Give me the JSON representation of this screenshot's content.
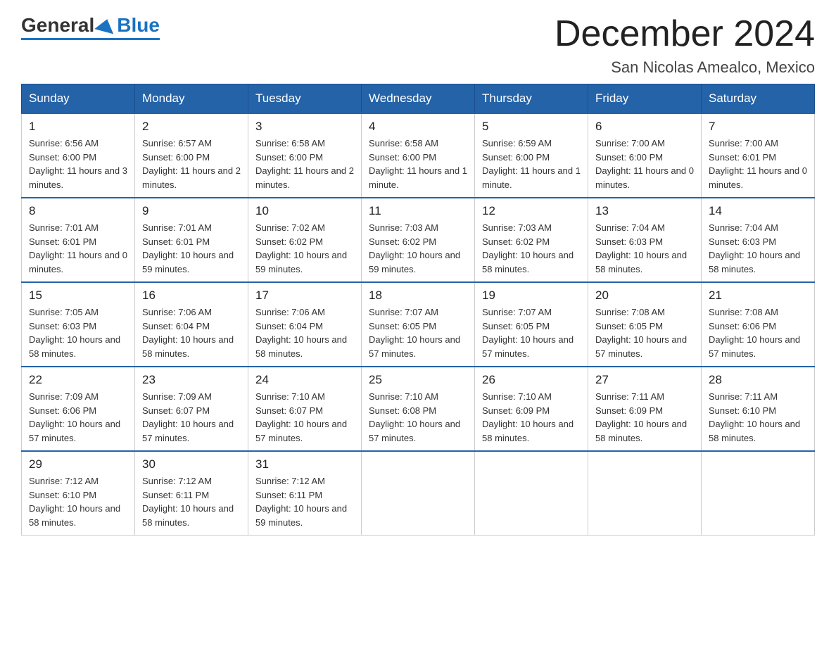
{
  "logo": {
    "general": "General",
    "blue": "Blue"
  },
  "header": {
    "month": "December 2024",
    "location": "San Nicolas Amealco, Mexico"
  },
  "days_of_week": [
    "Sunday",
    "Monday",
    "Tuesday",
    "Wednesday",
    "Thursday",
    "Friday",
    "Saturday"
  ],
  "weeks": [
    [
      {
        "day": "1",
        "sunrise": "6:56 AM",
        "sunset": "6:00 PM",
        "daylight": "11 hours and 3 minutes."
      },
      {
        "day": "2",
        "sunrise": "6:57 AM",
        "sunset": "6:00 PM",
        "daylight": "11 hours and 2 minutes."
      },
      {
        "day": "3",
        "sunrise": "6:58 AM",
        "sunset": "6:00 PM",
        "daylight": "11 hours and 2 minutes."
      },
      {
        "day": "4",
        "sunrise": "6:58 AM",
        "sunset": "6:00 PM",
        "daylight": "11 hours and 1 minute."
      },
      {
        "day": "5",
        "sunrise": "6:59 AM",
        "sunset": "6:00 PM",
        "daylight": "11 hours and 1 minute."
      },
      {
        "day": "6",
        "sunrise": "7:00 AM",
        "sunset": "6:00 PM",
        "daylight": "11 hours and 0 minutes."
      },
      {
        "day": "7",
        "sunrise": "7:00 AM",
        "sunset": "6:01 PM",
        "daylight": "11 hours and 0 minutes."
      }
    ],
    [
      {
        "day": "8",
        "sunrise": "7:01 AM",
        "sunset": "6:01 PM",
        "daylight": "11 hours and 0 minutes."
      },
      {
        "day": "9",
        "sunrise": "7:01 AM",
        "sunset": "6:01 PM",
        "daylight": "10 hours and 59 minutes."
      },
      {
        "day": "10",
        "sunrise": "7:02 AM",
        "sunset": "6:02 PM",
        "daylight": "10 hours and 59 minutes."
      },
      {
        "day": "11",
        "sunrise": "7:03 AM",
        "sunset": "6:02 PM",
        "daylight": "10 hours and 59 minutes."
      },
      {
        "day": "12",
        "sunrise": "7:03 AM",
        "sunset": "6:02 PM",
        "daylight": "10 hours and 58 minutes."
      },
      {
        "day": "13",
        "sunrise": "7:04 AM",
        "sunset": "6:03 PM",
        "daylight": "10 hours and 58 minutes."
      },
      {
        "day": "14",
        "sunrise": "7:04 AM",
        "sunset": "6:03 PM",
        "daylight": "10 hours and 58 minutes."
      }
    ],
    [
      {
        "day": "15",
        "sunrise": "7:05 AM",
        "sunset": "6:03 PM",
        "daylight": "10 hours and 58 minutes."
      },
      {
        "day": "16",
        "sunrise": "7:06 AM",
        "sunset": "6:04 PM",
        "daylight": "10 hours and 58 minutes."
      },
      {
        "day": "17",
        "sunrise": "7:06 AM",
        "sunset": "6:04 PM",
        "daylight": "10 hours and 58 minutes."
      },
      {
        "day": "18",
        "sunrise": "7:07 AM",
        "sunset": "6:05 PM",
        "daylight": "10 hours and 57 minutes."
      },
      {
        "day": "19",
        "sunrise": "7:07 AM",
        "sunset": "6:05 PM",
        "daylight": "10 hours and 57 minutes."
      },
      {
        "day": "20",
        "sunrise": "7:08 AM",
        "sunset": "6:05 PM",
        "daylight": "10 hours and 57 minutes."
      },
      {
        "day": "21",
        "sunrise": "7:08 AM",
        "sunset": "6:06 PM",
        "daylight": "10 hours and 57 minutes."
      }
    ],
    [
      {
        "day": "22",
        "sunrise": "7:09 AM",
        "sunset": "6:06 PM",
        "daylight": "10 hours and 57 minutes."
      },
      {
        "day": "23",
        "sunrise": "7:09 AM",
        "sunset": "6:07 PM",
        "daylight": "10 hours and 57 minutes."
      },
      {
        "day": "24",
        "sunrise": "7:10 AM",
        "sunset": "6:07 PM",
        "daylight": "10 hours and 57 minutes."
      },
      {
        "day": "25",
        "sunrise": "7:10 AM",
        "sunset": "6:08 PM",
        "daylight": "10 hours and 57 minutes."
      },
      {
        "day": "26",
        "sunrise": "7:10 AM",
        "sunset": "6:09 PM",
        "daylight": "10 hours and 58 minutes."
      },
      {
        "day": "27",
        "sunrise": "7:11 AM",
        "sunset": "6:09 PM",
        "daylight": "10 hours and 58 minutes."
      },
      {
        "day": "28",
        "sunrise": "7:11 AM",
        "sunset": "6:10 PM",
        "daylight": "10 hours and 58 minutes."
      }
    ],
    [
      {
        "day": "29",
        "sunrise": "7:12 AM",
        "sunset": "6:10 PM",
        "daylight": "10 hours and 58 minutes."
      },
      {
        "day": "30",
        "sunrise": "7:12 AM",
        "sunset": "6:11 PM",
        "daylight": "10 hours and 58 minutes."
      },
      {
        "day": "31",
        "sunrise": "7:12 AM",
        "sunset": "6:11 PM",
        "daylight": "10 hours and 59 minutes."
      },
      null,
      null,
      null,
      null
    ]
  ]
}
